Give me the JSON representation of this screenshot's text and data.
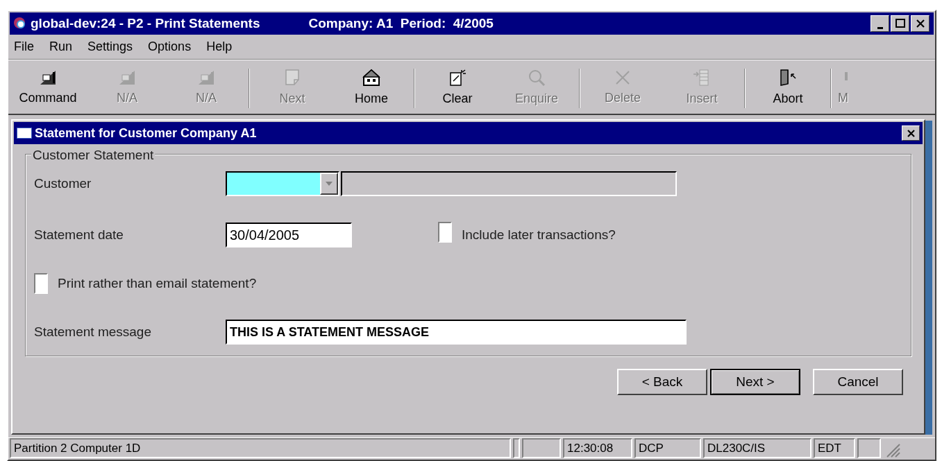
{
  "window": {
    "title": "global-dev:24 - P2 - Print Statements",
    "context": "Company: A1  Period:  4/2005"
  },
  "menu": [
    "File",
    "Run",
    "Settings",
    "Options",
    "Help"
  ],
  "toolbar_groups": [
    {
      "items": [
        {
          "kind": "f1",
          "label": "Command",
          "disabled": false
        },
        {
          "kind": "f2",
          "label": "N/A",
          "disabled": true
        },
        {
          "kind": "f3",
          "label": "N/A",
          "disabled": true
        }
      ]
    },
    {
      "items": [
        {
          "kind": "next",
          "label": "Next",
          "disabled": true
        },
        {
          "kind": "home",
          "label": "Home",
          "disabled": false
        }
      ]
    },
    {
      "items": [
        {
          "kind": "clear",
          "label": "Clear",
          "disabled": false
        },
        {
          "kind": "enquire",
          "label": "Enquire",
          "disabled": true
        }
      ]
    },
    {
      "items": [
        {
          "kind": "delete",
          "label": "Delete",
          "disabled": true
        },
        {
          "kind": "insert",
          "label": "Insert",
          "disabled": true
        }
      ]
    },
    {
      "items": [
        {
          "kind": "abort",
          "label": "Abort",
          "disabled": false
        }
      ]
    },
    {
      "items": [
        {
          "kind": "more",
          "label": "M",
          "disabled": true
        }
      ]
    }
  ],
  "dialog": {
    "title": "Statement for Customer Company A1",
    "group": "Customer Statement",
    "customer": {
      "label": "Customer"
    },
    "statement_date": {
      "label": "Statement date",
      "value": "30/04/2005"
    },
    "include_later": {
      "label": "Include later transactions?",
      "checked": false
    },
    "print_rather": {
      "label": "Print rather than email statement?",
      "checked": false
    },
    "message": {
      "label": "Statement message",
      "value": "THIS IS A STATEMENT MESSAGE"
    },
    "buttons": [
      {
        "label": "< Back",
        "default": false
      },
      {
        "label": "Next >",
        "default": true
      },
      {
        "label": "Cancel",
        "default": false
      }
    ]
  },
  "status_bar": [
    "Partition 2 Computer 1D",
    "12:30:08",
    "DCP",
    "DL230C/IS",
    "EDT"
  ]
}
